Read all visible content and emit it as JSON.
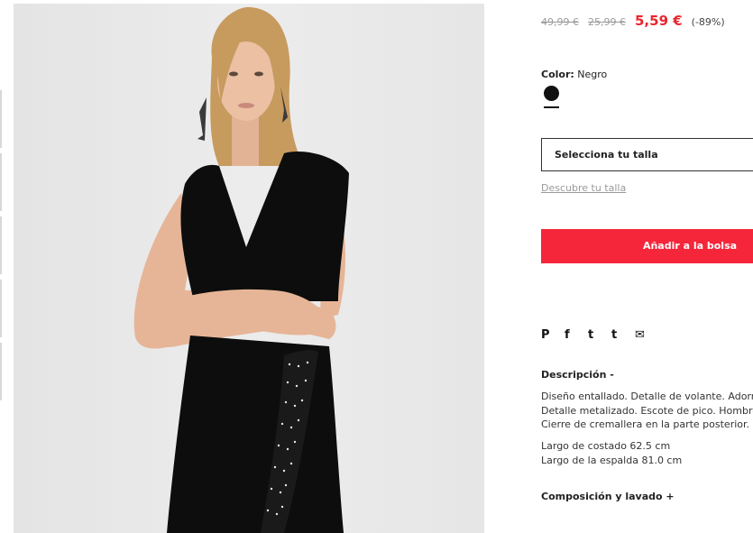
{
  "product": {
    "image_alt": "Woman wearing black sleeveless V-neck fitted dress with polka-dot ruffle"
  },
  "prices": {
    "original": "49,99 €",
    "previous": "25,99 €",
    "current": "5,59 €",
    "discount": "(-89%)",
    "current_color": "#e8262d"
  },
  "color": {
    "label": "Color:",
    "value": "Negro",
    "swatch_hex": "#111111"
  },
  "size": {
    "select_label": "Selecciona tu talla",
    "guide_link": "Descubre tu talla"
  },
  "cart": {
    "add_label": "Añadir a la bolsa",
    "button_color": "#f5263a"
  },
  "share": {
    "icons": [
      "pinterest-icon",
      "facebook-icon",
      "twitter-icon",
      "tumblr-icon",
      "mail-icon"
    ],
    "glyphs": [
      "P",
      "f",
      "t",
      "t",
      "✉"
    ]
  },
  "description": {
    "title": "Descripción -",
    "lines": [
      "Diseño entallado. Detalle de volante. Adorno",
      "Detalle metalizado. Escote de pico. Hombrer",
      "Cierre de cremallera en la parte posterior."
    ],
    "measures": [
      "Largo de costado 62.5 cm",
      "Largo de la espalda 81.0 cm"
    ]
  },
  "composition": {
    "title": "Composición y lavado +"
  }
}
